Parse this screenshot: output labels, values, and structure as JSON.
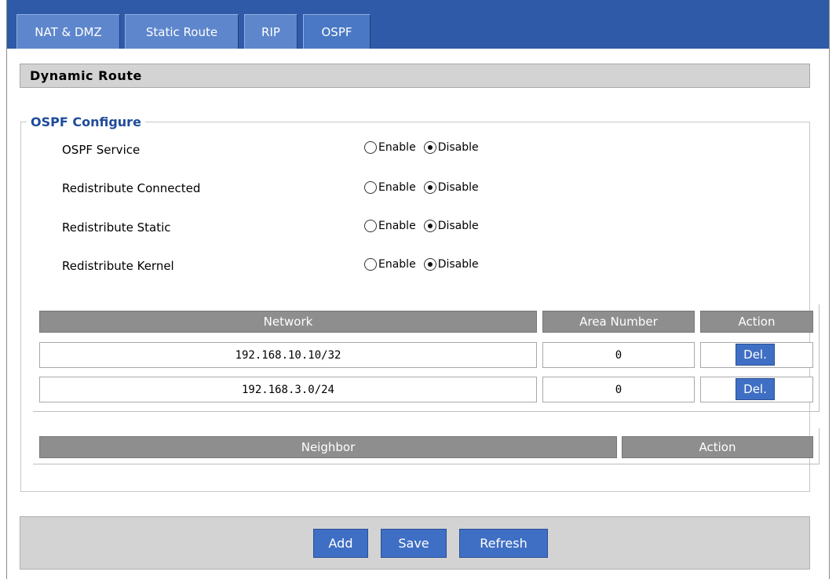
{
  "tabs": [
    {
      "label": "NAT & DMZ"
    },
    {
      "label": "Static Route"
    },
    {
      "label": "RIP"
    },
    {
      "label": "OSPF"
    }
  ],
  "section_title": "Dynamic Route",
  "fieldset_legend": "OSPF Configure",
  "settings": [
    {
      "label": "OSPF Service",
      "enable": "Enable",
      "disable": "Disable",
      "selected": "Disable"
    },
    {
      "label": "Redistribute Connected",
      "enable": "Enable",
      "disable": "Disable",
      "selected": "Disable"
    },
    {
      "label": "Redistribute Static",
      "enable": "Enable",
      "disable": "Disable",
      "selected": "Disable"
    },
    {
      "label": "Redistribute Kernel",
      "enable": "Enable",
      "disable": "Disable",
      "selected": "Disable"
    }
  ],
  "network_table": {
    "headers": [
      "Network",
      "Area Number",
      "Action"
    ],
    "rows": [
      {
        "network": "192.168.10.10/32",
        "area": "0",
        "action": "Del."
      },
      {
        "network": "192.168.3.0/24",
        "area": "0",
        "action": "Del."
      }
    ]
  },
  "neighbor_table": {
    "headers": [
      "Neighbor",
      "Action"
    ]
  },
  "buttons": {
    "add": "Add",
    "save": "Save",
    "refresh": "Refresh"
  },
  "colors": {
    "tab_bar": "#2e5aa8",
    "tab": "#5d86cc",
    "button": "#3f6fc4",
    "legend": "#1f4b9a",
    "table_header": "#8e8e8e"
  }
}
